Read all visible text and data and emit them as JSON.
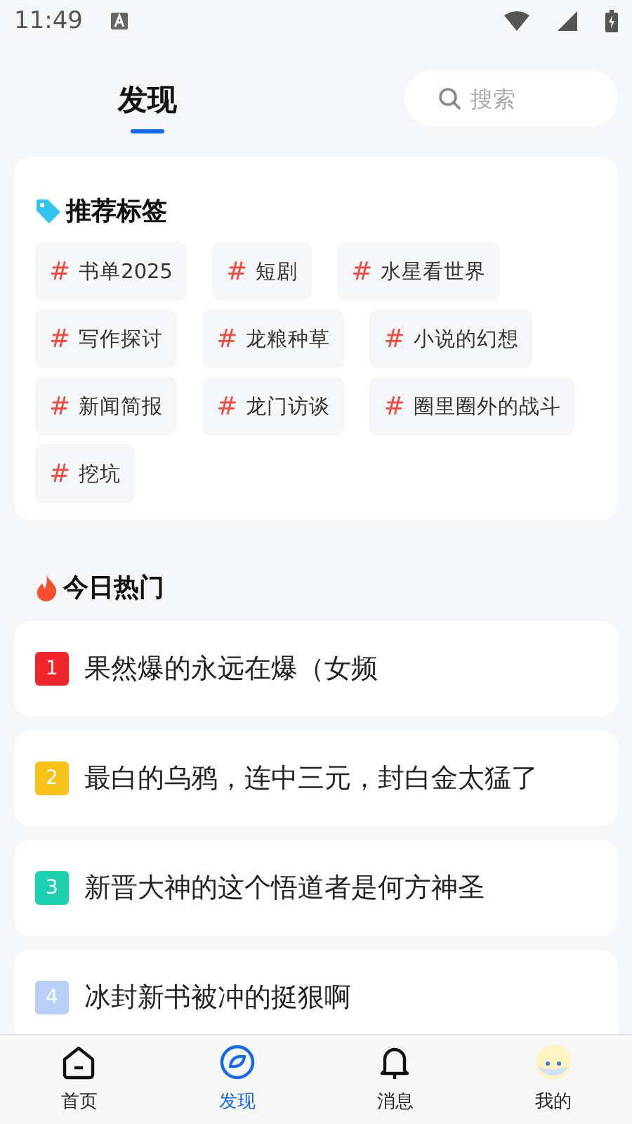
{
  "status_bar": {
    "time": "11:49"
  },
  "header": {
    "tabs": [
      {
        "label": "发现",
        "selected": true
      }
    ],
    "search": {
      "placeholder": "搜索"
    }
  },
  "tags_card": {
    "title": "推荐标签",
    "tags": [
      {
        "hash": "#",
        "label": "书单2025"
      },
      {
        "hash": "#",
        "label": "短剧"
      },
      {
        "hash": "#",
        "label": "水星看世界"
      },
      {
        "hash": "#",
        "label": "写作探讨"
      },
      {
        "hash": "#",
        "label": "龙粮种草"
      },
      {
        "hash": "#",
        "label": "小说的幻想"
      },
      {
        "hash": "#",
        "label": "新闻简报"
      },
      {
        "hash": "#",
        "label": "龙门访谈"
      },
      {
        "hash": "#",
        "label": "圈里圈外的战斗"
      },
      {
        "hash": "#",
        "label": "挖坑"
      }
    ]
  },
  "hot": {
    "title": "今日热门",
    "items": [
      {
        "rank": "1",
        "color": "#f0262a",
        "title": "果然爆的永远在爆（女频"
      },
      {
        "rank": "2",
        "color": "#f8c21b",
        "title": "最白的乌鸦，连中三元，封白金太猛了"
      },
      {
        "rank": "3",
        "color": "#1dd1b0",
        "title": "新晋大神的这个悟道者是何方神圣"
      },
      {
        "rank": "4",
        "color": "#b8cff8",
        "title": "冰封新书被冲的挺狠啊"
      }
    ]
  },
  "nav": [
    {
      "kind": "home",
      "label": "首页",
      "selected": false
    },
    {
      "kind": "discover",
      "label": "发现",
      "selected": true
    },
    {
      "kind": "bell",
      "label": "消息",
      "selected": false
    },
    {
      "kind": "avatar",
      "label": "我的",
      "selected": false
    }
  ]
}
